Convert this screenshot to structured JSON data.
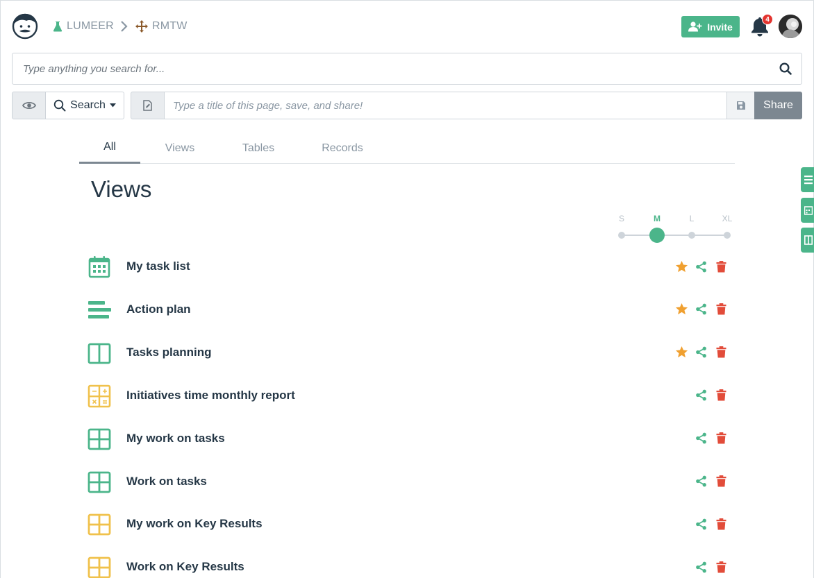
{
  "header": {
    "logo": "lumeer-logo",
    "organization": {
      "icon": "flask-icon",
      "label": "LUMEER",
      "color": "#4bb58a"
    },
    "separator": "chevron-right-icon",
    "project": {
      "icon": "arrows-move-icon",
      "label": "RMTW",
      "color": "#8b5a2b"
    },
    "invite_label": "Invite",
    "notifications_count": "4",
    "avatar": "user-avatar"
  },
  "search": {
    "placeholder": "Type anything you search for...",
    "icon": "search-icon"
  },
  "toolbar": {
    "perspective_icon": "eye-icon",
    "search_dropdown_label": "Search",
    "page_icon": "file-edit-icon",
    "title_placeholder": "Type a title of this page, save, and share!",
    "save_icon": "floppy-disk-icon",
    "share_label": "Share"
  },
  "tabs": [
    {
      "label": "All",
      "active": true
    },
    {
      "label": "Views",
      "active": false
    },
    {
      "label": "Tables",
      "active": false
    },
    {
      "label": "Records",
      "active": false
    }
  ],
  "section_title": "Views",
  "size_selector": {
    "options": [
      "S",
      "M",
      "L",
      "XL"
    ],
    "selected": "M"
  },
  "views": [
    {
      "name": "My task list",
      "icon": "calendar-icon",
      "color": "#4bb58a",
      "favorite": true
    },
    {
      "name": "Action plan",
      "icon": "gantt-icon",
      "color": "#4bb58a",
      "favorite": true
    },
    {
      "name": "Tasks planning",
      "icon": "kanban-icon",
      "color": "#4bb58a",
      "favorite": true
    },
    {
      "name": "Initiatives time monthly report",
      "icon": "pivot-icon",
      "color": "#f0c14b",
      "favorite": false
    },
    {
      "name": "My work on tasks",
      "icon": "table-icon",
      "color": "#4bb58a",
      "favorite": false
    },
    {
      "name": "Work on tasks",
      "icon": "table-icon",
      "color": "#4bb58a",
      "favorite": false
    },
    {
      "name": "My work on Key Results",
      "icon": "table-icon",
      "color": "#f0c14b",
      "favorite": false
    },
    {
      "name": "Work on Key Results",
      "icon": "table-icon",
      "color": "#f0c14b",
      "favorite": false
    }
  ],
  "colors": {
    "accent": "#4bb58a",
    "favorite": "#f0a030",
    "delete": "#e24c3a",
    "text": "#253746"
  },
  "side_tabs": [
    "list-icon",
    "calendar-icon",
    "columns-icon"
  ]
}
